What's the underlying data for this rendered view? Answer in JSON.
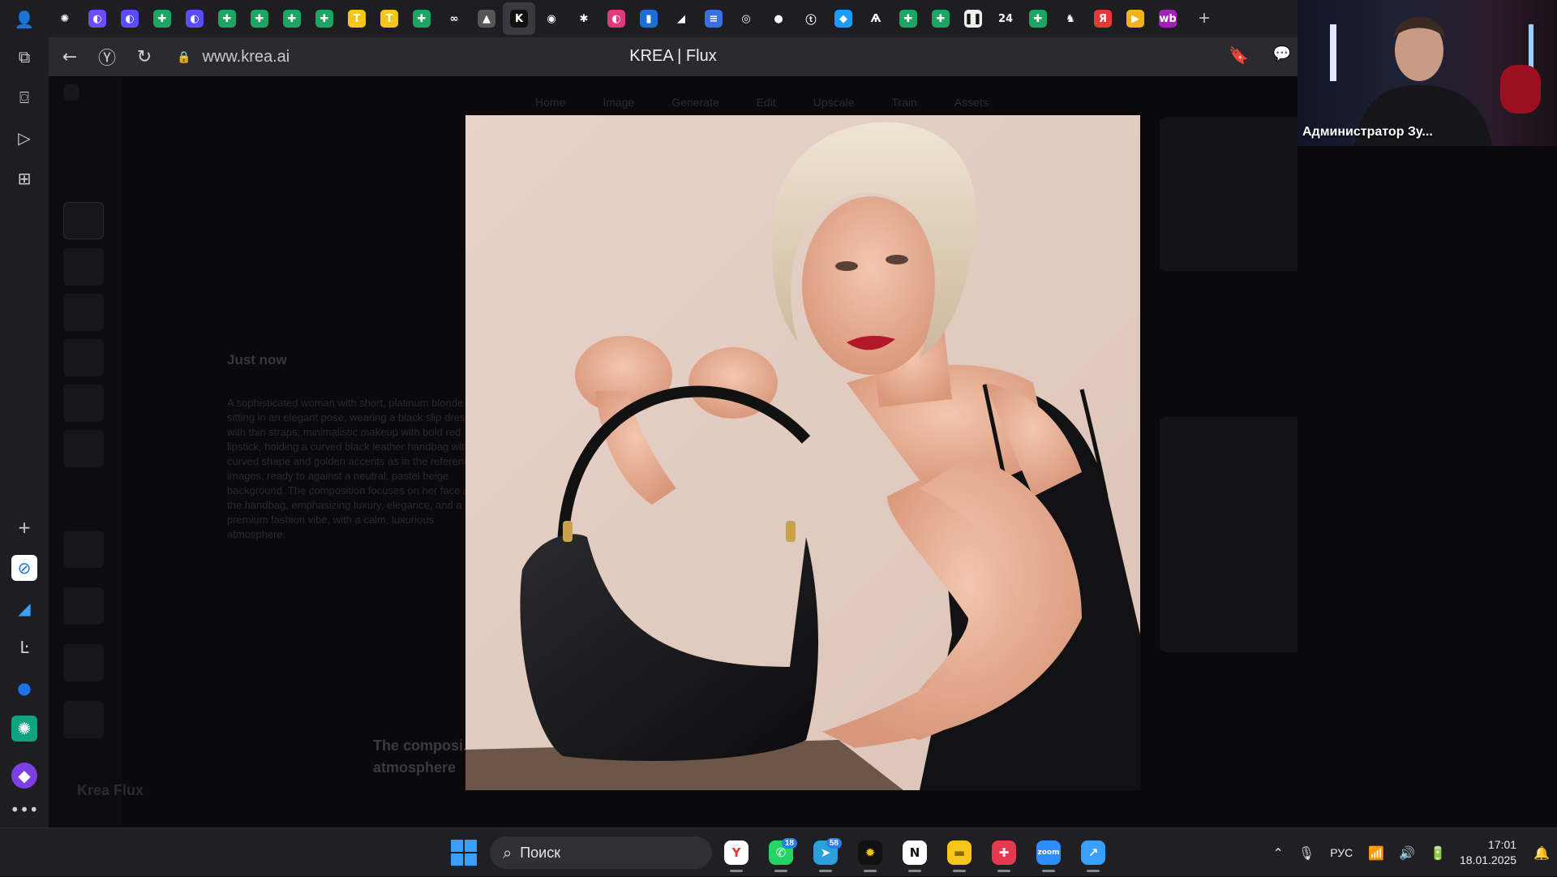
{
  "browser": {
    "url": "www.krea.ai",
    "page_title": "KREA | Flux",
    "tabs": [
      {
        "icon": "chatgpt-icon",
        "bg": "#1d1d22",
        "glyph": "✺"
      },
      {
        "icon": "app-icon",
        "bg": "#6b4cff",
        "glyph": "◐"
      },
      {
        "icon": "app-icon",
        "bg": "#5a4cff",
        "glyph": "◐"
      },
      {
        "icon": "sheets-icon",
        "bg": "#1fa463",
        "glyph": "✚"
      },
      {
        "icon": "app-icon",
        "bg": "#5a4cff",
        "glyph": "◐"
      },
      {
        "icon": "sheets-icon",
        "bg": "#1fa463",
        "glyph": "✚"
      },
      {
        "icon": "sheets-icon",
        "bg": "#1fa463",
        "glyph": "✚"
      },
      {
        "icon": "sheets-icon",
        "bg": "#1fa463",
        "glyph": "✚"
      },
      {
        "icon": "sheets-icon",
        "bg": "#1fa463",
        "glyph": "✚"
      },
      {
        "icon": "yellow-t-icon",
        "bg": "#f5c518",
        "glyph": "T"
      },
      {
        "icon": "yellow-t-icon",
        "bg": "#f5c518",
        "glyph": "T"
      },
      {
        "icon": "sheets-icon",
        "bg": "#1fa463",
        "glyph": "✚"
      },
      {
        "icon": "vk-icon",
        "bg": "#1d1d22",
        "glyph": "∞"
      },
      {
        "icon": "image-icon",
        "bg": "#555",
        "glyph": "▲"
      },
      {
        "icon": "krea-icon",
        "bg": "#111",
        "glyph": "K"
      },
      {
        "icon": "app-icon",
        "bg": "#1d1d22",
        "glyph": "◉"
      },
      {
        "icon": "app-icon",
        "bg": "#1d1d22",
        "glyph": "✱"
      },
      {
        "icon": "app-icon",
        "bg": "#e03a7a",
        "glyph": "◐"
      },
      {
        "icon": "trello-icon",
        "bg": "#1c6fd6",
        "glyph": "▮"
      },
      {
        "icon": "app-icon",
        "bg": "#1d1d22",
        "glyph": "◢"
      },
      {
        "icon": "docs-icon",
        "bg": "#3b6fe0",
        "glyph": "≡"
      },
      {
        "icon": "app-icon",
        "bg": "#1d1d22",
        "glyph": "◎"
      },
      {
        "icon": "flag-icon",
        "bg": "#1d1d22",
        "glyph": "●"
      },
      {
        "icon": "app-icon",
        "bg": "#1d1d22",
        "glyph": "ⓣ"
      },
      {
        "icon": "chat-app-icon",
        "bg": "#1a9bff",
        "glyph": "◆"
      },
      {
        "icon": "app-icon",
        "bg": "#1d1d22",
        "glyph": "Ѧ"
      },
      {
        "icon": "sheets-icon",
        "bg": "#1fa463",
        "glyph": "✚"
      },
      {
        "icon": "sheets-icon",
        "bg": "#1fa463",
        "glyph": "✚"
      },
      {
        "icon": "pause-icon",
        "bg": "#eee",
        "glyph": "❚❚"
      },
      {
        "icon": "bitrix24-icon",
        "bg": "#1d1d22",
        "glyph": "24"
      },
      {
        "icon": "sheets-icon",
        "bg": "#1fa463",
        "glyph": "✚"
      },
      {
        "icon": "duck-icon",
        "bg": "#1d1d22",
        "glyph": "♞"
      },
      {
        "icon": "yandex-icon",
        "bg": "#e53935",
        "glyph": "Я"
      },
      {
        "icon": "app-icon",
        "bg": "#f2b21b",
        "glyph": "▶"
      },
      {
        "icon": "wb-icon",
        "bg": "#a020b8",
        "glyph": "wb"
      }
    ],
    "active_tab_index": 14,
    "new_tab_glyph": "+"
  },
  "page": {
    "nav": [
      "Home",
      "Image",
      "Generate",
      "Edit",
      "Upscale",
      "Train",
      "Assets"
    ],
    "history_time": "Just now",
    "history_prompt": "A sophisticated woman with short, platinum blonde hair, sitting in an elegant pose, wearing a black slip dress with thin straps, minimalistic makeup with bold red lipstick, holding a curved black leather handbag with a curved shape and golden accents as in the reference images, ready to against a neutral, pastel beige background. The composition focuses on her face and the handbag, emphasizing luxury, elegance, and a premium fashion vibe, with a calm, luxurious atmosphere.",
    "bottom_prompt": "The composi... emphasizing l... calm, luxurious atmosphere",
    "brand_footer": "Krea   Flux"
  },
  "webcam": {
    "label": "Администратор Зу..."
  },
  "taskbar": {
    "search_placeholder": "Поиск",
    "apps": [
      {
        "name": "yandex-browser-icon",
        "bg": "#fff",
        "fg": "#e53935",
        "glyph": "Y",
        "badge": ""
      },
      {
        "name": "whatsapp-icon",
        "bg": "#25d366",
        "fg": "#fff",
        "glyph": "✆",
        "badge": "18"
      },
      {
        "name": "telegram-icon",
        "bg": "#2aa1da",
        "fg": "#fff",
        "glyph": "➤",
        "badge": "58"
      },
      {
        "name": "app-spark-icon",
        "bg": "#111",
        "fg": "#f5c518",
        "glyph": "✹",
        "badge": ""
      },
      {
        "name": "notion-icon",
        "bg": "#fff",
        "fg": "#111",
        "glyph": "N",
        "badge": ""
      },
      {
        "name": "file-explorer-icon",
        "bg": "#f5c518",
        "fg": "#8a6a00",
        "glyph": "▬",
        "badge": ""
      },
      {
        "name": "red-app-icon",
        "bg": "#e53950",
        "fg": "#fff",
        "glyph": "✚",
        "badge": ""
      },
      {
        "name": "zoom-icon",
        "bg": "#2d8cff",
        "fg": "#fff",
        "glyph": "zoom",
        "badge": ""
      },
      {
        "name": "blue-app-icon",
        "bg": "#3aa0ff",
        "fg": "#fff",
        "glyph": "↗",
        "badge": ""
      }
    ],
    "language": "РУС",
    "time": "17:01",
    "date": "18.01.2025"
  }
}
